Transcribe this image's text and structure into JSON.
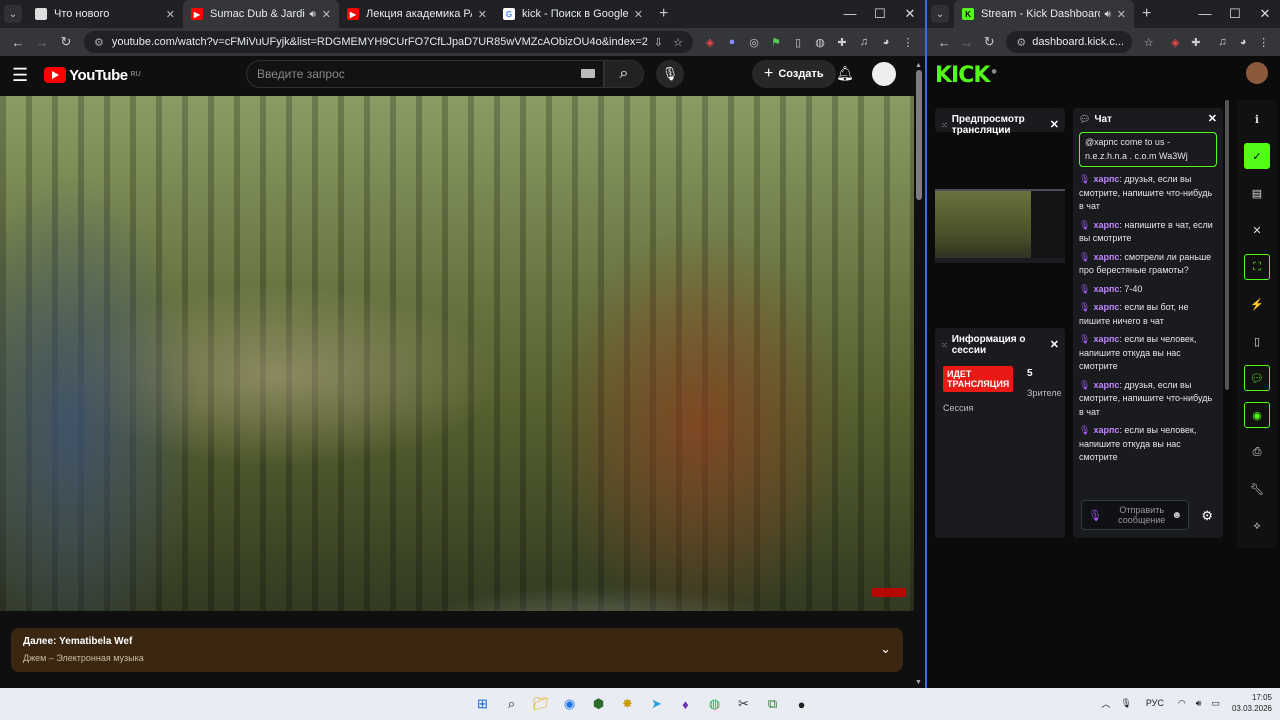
{
  "left_browser": {
    "tabs": [
      {
        "title": "Что нового",
        "favicon": "#ddd",
        "active": false
      },
      {
        "title": "Sumac Dub & Jardin Secret",
        "favicon": "#f00",
        "active": true,
        "sound": true
      },
      {
        "title": "Лекция академика РАН А. А.",
        "favicon": "#f00",
        "active": false
      },
      {
        "title": "kick - Поиск в Google",
        "favicon": "#4285f4",
        "active": false
      }
    ],
    "url": "youtube.com/watch?v=cFMiVuUFyjk&list=RDGMEMYH9CUrFO7CfLJpaD7UR85wVMZcAObizOU4o&index=2"
  },
  "youtube": {
    "logo": "YouTube",
    "region": "RU",
    "search_placeholder": "Введите запрос",
    "create_label": "Создать",
    "next_up_title": "Далее: Yematibela Wef",
    "next_up_subtitle": "Джем – Электронная музыка"
  },
  "right_browser": {
    "tab_title": "Stream - Kick Dashboard",
    "url": "dashboard.kick.c..."
  },
  "kick": {
    "logo": "KICK",
    "preview_title": "Предпросмотр трансляции",
    "session_title": "Информация о сессии",
    "live_badge": "ИДЕТ ТРАНСЛЯЦИЯ",
    "viewers_count": "5",
    "viewers_label": "Зрителе",
    "session_label": "Сессия",
    "chat_title": "Чат",
    "pinned": "@харпс come to us - n.e.z.h.n.a . c.o.m Wa3Wj",
    "messages": [
      {
        "user": "харпс",
        "text": "друзья, если вы смотрите, напишите что-нибудь в чат"
      },
      {
        "user": "харпс",
        "text": "напишите в чат, если вы смотрите"
      },
      {
        "user": "харпс",
        "text": "смотрели ли раньше про берестяные грамоты?"
      },
      {
        "user": "харпс",
        "text": "7-40"
      },
      {
        "user": "харпс",
        "text": "если вы бот, не пишите ничего в чат"
      },
      {
        "user": "харпс",
        "text": "если вы человек, напишите откуда вы нас смотрите"
      },
      {
        "user": "харпс",
        "text": "друзья, если вы смотрите, напишите что-нибудь в чат"
      },
      {
        "user": "харпс",
        "text": "если вы человек, напишите откуда вы нас смотрите"
      }
    ],
    "send_placeholder": "Отправить сообщение"
  },
  "taskbar": {
    "lang": "РУС",
    "time": "17:05",
    "date": "03.03.2026"
  }
}
